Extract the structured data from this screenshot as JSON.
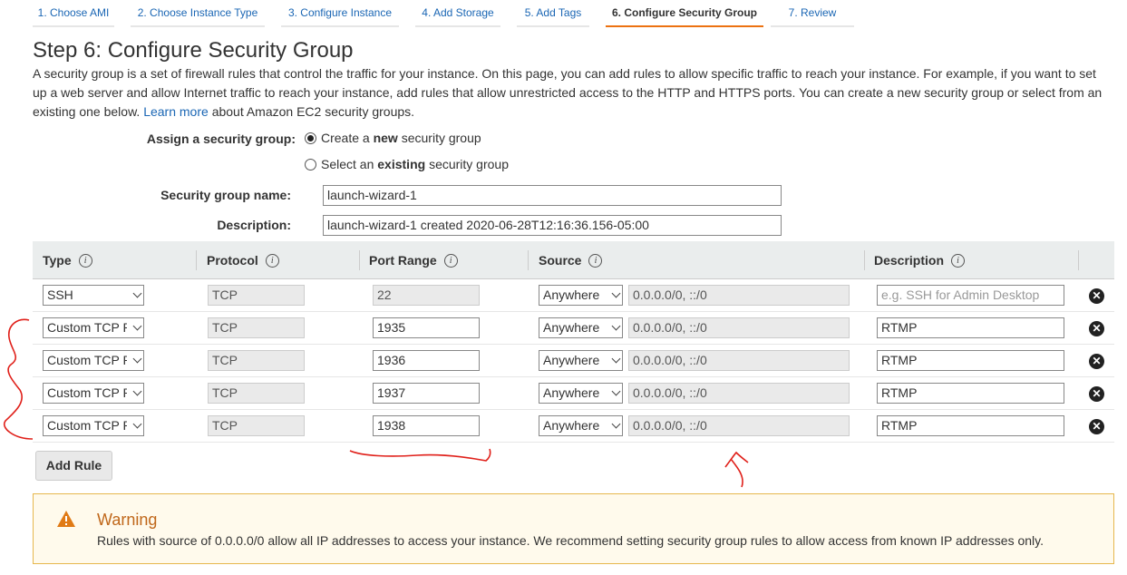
{
  "wizard": {
    "tabs": [
      {
        "label": "1. Choose AMI"
      },
      {
        "label": "2. Choose Instance Type"
      },
      {
        "label": "3. Configure Instance"
      },
      {
        "label": "4. Add Storage"
      },
      {
        "label": "5. Add Tags"
      },
      {
        "label": "6. Configure Security Group"
      },
      {
        "label": "7. Review"
      }
    ],
    "active_tab": "6. Configure Security Group"
  },
  "page": {
    "title": "Step 6: Configure Security Group",
    "intro_text": "A security group is a set of firewall rules that control the traffic for your instance. On this page, you can add rules to allow specific traffic to reach your instance. For example, if you want to set up a web server and allow Internet traffic to reach your instance, add rules that allow unrestricted access to the HTTP and HTTPS ports. You can create a new security group or select from an existing one below.",
    "learn_more": "Learn more",
    "intro_suffix": "about Amazon EC2 security groups."
  },
  "assign": {
    "label": "Assign a security group:",
    "option_new_prefix": "Create a",
    "option_new_bold": "new",
    "option_new_suffix": "security group",
    "option_existing_prefix": "Select an",
    "option_existing_bold": "existing",
    "option_existing_suffix": "security group",
    "selected": "new"
  },
  "group": {
    "name_label": "Security group name:",
    "name_value": "launch-wizard-1",
    "description_label": "Description:",
    "description_value": "launch-wizard-1 created 2020-06-28T12:16:36.156-05:00"
  },
  "table": {
    "headers": {
      "type": "Type",
      "protocol": "Protocol",
      "port_range": "Port Range",
      "source": "Source",
      "description": "Description"
    },
    "info_glyph": "i",
    "remove_glyph": "✕",
    "rows": [
      {
        "type": "SSH",
        "protocol": "TCP",
        "port": "22",
        "source": "Anywhere",
        "cidr": "0.0.0.0/0, ::/0",
        "description": "",
        "description_placeholder": "e.g. SSH for Admin Desktop"
      },
      {
        "type": "Custom TCP R",
        "protocol": "TCP",
        "port": "1935",
        "source": "Anywhere",
        "cidr": "0.0.0.0/0, ::/0",
        "description": "RTMP",
        "description_placeholder": ""
      },
      {
        "type": "Custom TCP R",
        "protocol": "TCP",
        "port": "1936",
        "source": "Anywhere",
        "cidr": "0.0.0.0/0, ::/0",
        "description": "RTMP",
        "description_placeholder": ""
      },
      {
        "type": "Custom TCP R",
        "protocol": "TCP",
        "port": "1937",
        "source": "Anywhere",
        "cidr": "0.0.0.0/0, ::/0",
        "description": "RTMP",
        "description_placeholder": ""
      },
      {
        "type": "Custom TCP R",
        "protocol": "TCP",
        "port": "1938",
        "source": "Anywhere",
        "cidr": "0.0.0.0/0, ::/0",
        "description": "RTMP",
        "description_placeholder": ""
      }
    ]
  },
  "add_rule_label": "Add Rule",
  "warning": {
    "title": "Warning",
    "text": "Rules with source of 0.0.0.0/0 allow all IP addresses to access your instance. We recommend setting security group rules to allow access from known IP addresses only.",
    "icon": "warning-triangle-icon"
  },
  "colors": {
    "link": "#1a66b4",
    "active_tab_underline": "#ec7211",
    "warning_border": "#e6b74d",
    "warning_title": "#c0671a",
    "annotation": "#e0201a"
  }
}
